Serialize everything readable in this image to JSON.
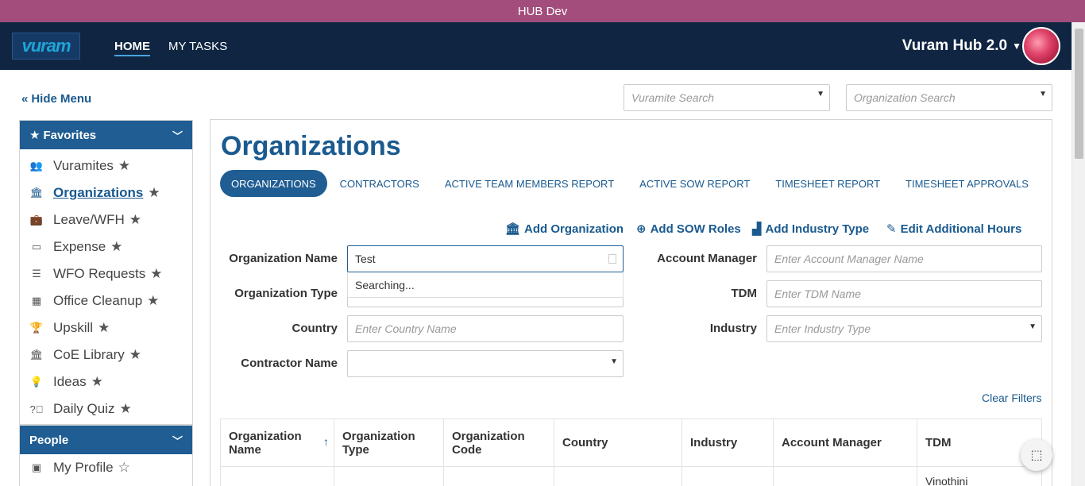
{
  "window": {
    "title": "HUB Dev"
  },
  "nav": {
    "logo_text": "vuram",
    "home": "HOME",
    "my_tasks": "MY TASKS",
    "app_name": "Vuram Hub 2.0"
  },
  "search": {
    "vuramite_placeholder": "Vuramite Search",
    "org_placeholder": "Organization Search"
  },
  "hide_menu": "Hide Menu",
  "sidebar": {
    "favorites_title": "Favorites",
    "items": [
      {
        "label": "Vuramites",
        "icon": "users-icon"
      },
      {
        "label": "Organizations",
        "icon": "bank-icon"
      },
      {
        "label": "Leave/WFH",
        "icon": "briefcase-icon"
      },
      {
        "label": "Expense",
        "icon": "money-icon"
      },
      {
        "label": "WFO Requests",
        "icon": "list-card-icon"
      },
      {
        "label": "Office Cleanup",
        "icon": "building-icon"
      },
      {
        "label": "Upskill",
        "icon": "trophy-icon"
      },
      {
        "label": "CoE Library",
        "icon": "bank-icon"
      },
      {
        "label": "Ideas",
        "icon": "lightbulb-icon"
      },
      {
        "label": "Daily Quiz",
        "icon": "question-icon"
      }
    ],
    "people_title": "People",
    "people_items": [
      {
        "label": "My Profile",
        "icon": "id-card-icon"
      }
    ]
  },
  "main": {
    "title": "Organizations",
    "tabs": [
      "ORGANIZATIONS",
      "CONTRACTORS",
      "ACTIVE TEAM MEMBERS REPORT",
      "ACTIVE SOW REPORT",
      "TIMESHEET REPORT",
      "TIMESHEET APPROVALS"
    ],
    "actions": {
      "add_org": "Add Organization",
      "add_sow": "Add SOW Roles",
      "add_industry": "Add Industry Type",
      "edit_hours": "Edit Additional Hours"
    },
    "filters": {
      "org_name_label": "Organization Name",
      "org_name_value": "Test",
      "searching_text": "Searching...",
      "org_type_label": "Organization Type",
      "country_label": "Country",
      "country_placeholder": "Enter Country Name",
      "contractor_label": "Contractor Name",
      "account_manager_label": "Account Manager",
      "account_manager_placeholder": "Enter Account Manager Name",
      "tdm_label": "TDM",
      "tdm_placeholder": "Enter TDM Name",
      "industry_label": "Industry",
      "industry_placeholder": "Enter Industry Type"
    },
    "clear_filters": "Clear Filters",
    "grid": {
      "columns": [
        "Organization Name",
        "Organization Type",
        "Organization Code",
        "Country",
        "Industry",
        "Account Manager",
        "TDM"
      ],
      "first_row_tdm": "Vinothini"
    }
  }
}
